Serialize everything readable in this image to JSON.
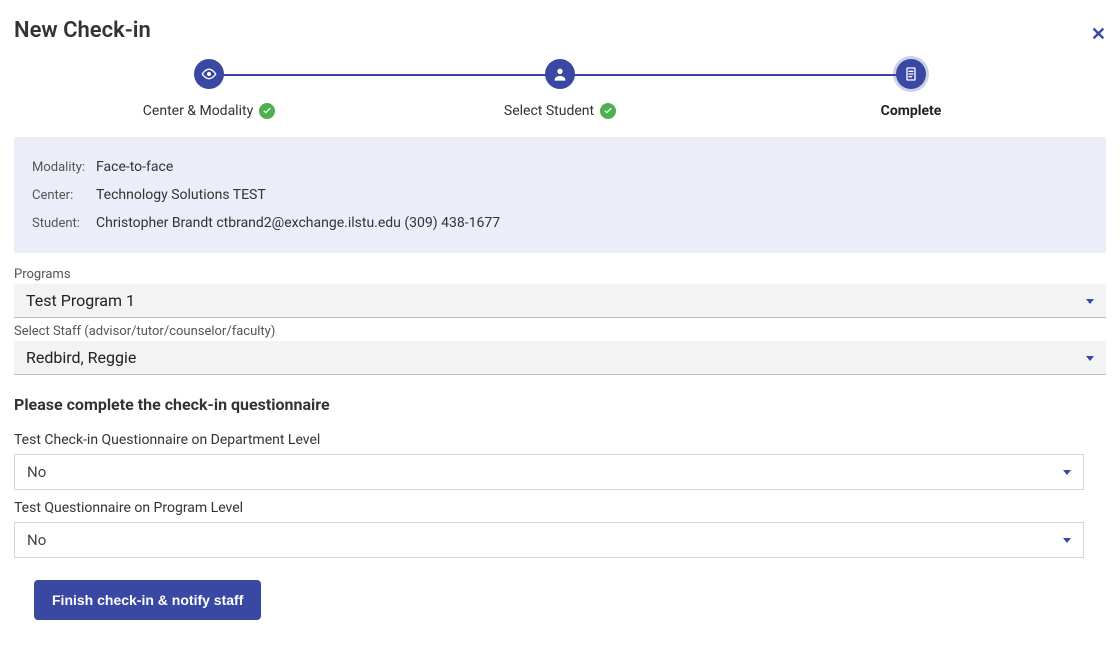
{
  "title": "New Check-in",
  "stepper": {
    "steps": [
      {
        "label": "Center & Modality",
        "done": true,
        "active": false,
        "icon": "eye"
      },
      {
        "label": "Select Student",
        "done": true,
        "active": false,
        "icon": "user"
      },
      {
        "label": "Complete",
        "done": false,
        "active": true,
        "icon": "doc"
      }
    ]
  },
  "summary": {
    "modality_label": "Modality:",
    "modality_value": "Face-to-face",
    "center_label": "Center:",
    "center_value": "Technology Solutions TEST",
    "student_label": "Student:",
    "student_value": "Christopher Brandt ctbrand2@exchange.ilstu.edu (309) 438-1677"
  },
  "programs": {
    "label": "Programs",
    "value": "Test Program 1"
  },
  "staff": {
    "label": "Select Staff (advisor/tutor/counselor/faculty)",
    "value": "Redbird, Reggie"
  },
  "questionnaire_heading": "Please complete the check-in questionnaire",
  "q1": {
    "label": "Test Check-in Questionnaire on Department Level",
    "value": "No"
  },
  "q2": {
    "label": "Test Questionnaire on Program Level",
    "value": "No"
  },
  "finish_label": "Finish check-in & notify staff"
}
